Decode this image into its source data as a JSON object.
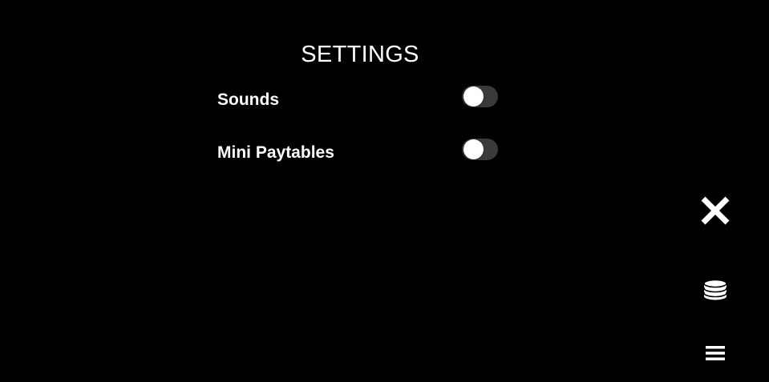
{
  "settings": {
    "title": "SETTINGS",
    "options": [
      {
        "label": "Sounds",
        "enabled": false
      },
      {
        "label": "Mini Paytables",
        "enabled": false
      }
    ]
  },
  "side_buttons": [
    {
      "icon": "close-icon"
    },
    {
      "icon": "coins-icon"
    },
    {
      "icon": "menu-icon"
    }
  ],
  "colors": {
    "background": "#000000",
    "text": "#ffffff",
    "toggle_track": "#3a3a3a",
    "toggle_knob": "#ffffff"
  }
}
